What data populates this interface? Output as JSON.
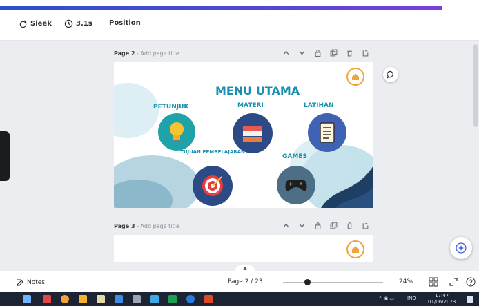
{
  "toolbar": {
    "item1_label": "Sleek",
    "timer_label": "3.1s",
    "position_label": "Position"
  },
  "pages": [
    {
      "label": "Page 2",
      "title_placeholder": "Add page title"
    },
    {
      "label": "Page 3",
      "title_placeholder": "Add page title"
    }
  ],
  "slide": {
    "title": "MENU UTAMA",
    "menu": [
      {
        "label": "PETUNJUK",
        "icon": "lightbulb-icon",
        "color": "#1fa3a8"
      },
      {
        "label": "MATERI",
        "icon": "books-icon",
        "color": "#2c4a86"
      },
      {
        "label": "LATIHAN",
        "icon": "worksheet-icon",
        "color": "#3f62b4"
      },
      {
        "label": "TUJUAN PEMBELAJARAN",
        "icon": "target-icon",
        "color": "#2c4a86"
      },
      {
        "label": "GAMES",
        "icon": "gamepad-icon",
        "color": "#4c6f86"
      }
    ],
    "title_color": "#1a8fb0",
    "label_color": "#1a8fb0",
    "home_button_color": "#f0a53c"
  },
  "bottombar": {
    "notes_label": "Notes",
    "page_indicator": "Page 2 / 23",
    "zoom_percent": "24%",
    "zoom_level": 0.24
  },
  "taskbar": {
    "clock_time": "17:47",
    "clock_date": "01/06/2023",
    "lang": "IND"
  },
  "colors": {
    "accent_gradient_start": "#2b50c8",
    "accent_gradient_end": "#7c3fd8",
    "taskbar_bg": "#1c2433"
  }
}
